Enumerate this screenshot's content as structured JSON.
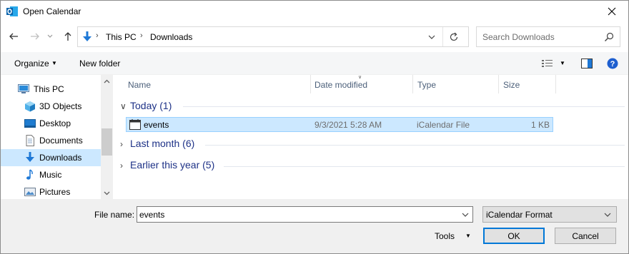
{
  "window": {
    "title": "Open Calendar",
    "accent": "#0078d7",
    "app_icon": "outlook-icon"
  },
  "address": {
    "crumbs": [
      "This PC",
      "Downloads"
    ],
    "search_placeholder": "Search Downloads"
  },
  "toolbar": {
    "organize_label": "Organize",
    "new_folder_label": "New folder"
  },
  "nav": {
    "items": [
      {
        "label": "This PC",
        "icon": "computer-icon"
      },
      {
        "label": "3D Objects",
        "icon": "cube-icon"
      },
      {
        "label": "Desktop",
        "icon": "desktop-icon"
      },
      {
        "label": "Documents",
        "icon": "document-icon"
      },
      {
        "label": "Downloads",
        "icon": "download-arrow-icon",
        "selected": true
      },
      {
        "label": "Music",
        "icon": "music-note-icon"
      },
      {
        "label": "Pictures",
        "icon": "picture-icon"
      }
    ]
  },
  "columns": [
    "Name",
    "Date modified",
    "Type",
    "Size"
  ],
  "groups": [
    {
      "label": "Today (1)",
      "expanded": true
    },
    {
      "label": "Last month (6)",
      "expanded": false
    },
    {
      "label": "Earlier this year (5)",
      "expanded": false
    }
  ],
  "files": [
    {
      "name": "events",
      "date": "9/3/2021 5:28 AM",
      "type": "iCalendar File",
      "size": "1 KB"
    }
  ],
  "bottom": {
    "file_name_label": "File name:",
    "file_name_value": "events",
    "file_type_value": "iCalendar Format",
    "tools_label": "Tools",
    "ok_label": "OK",
    "cancel_label": "Cancel"
  }
}
